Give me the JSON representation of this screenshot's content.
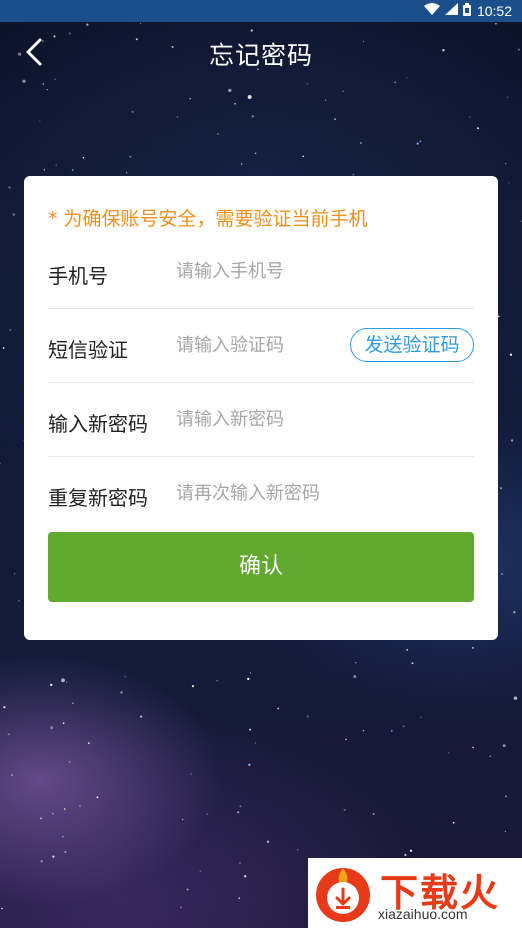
{
  "status_bar": {
    "time": "10:52",
    "icons": [
      "wifi-icon",
      "signal-icon",
      "battery-icon"
    ]
  },
  "header": {
    "title": "忘记密码",
    "back_icon": "back-arrow-icon"
  },
  "form": {
    "notice": "* 为确保账号安全，需要验证当前手机",
    "phone": {
      "label": "手机号",
      "placeholder": "请输入手机号",
      "value": ""
    },
    "sms": {
      "label": "短信验证",
      "placeholder": "请输入验证码",
      "value": "",
      "send_button": "发送验证码"
    },
    "new_password": {
      "label": "输入新密码",
      "placeholder": "请输入新密码",
      "value": ""
    },
    "repeat_password": {
      "label": "重复新密码",
      "placeholder": "请再次输入新密码",
      "value": ""
    },
    "confirm_button": "确认"
  },
  "watermark": {
    "brand": "下载火",
    "url": "xiazaihuo.com"
  },
  "colors": {
    "status_bar": "#1a4f8c",
    "notice": "#f0901c",
    "accent_blue": "#2f9be3",
    "confirm_green": "#62a92f",
    "brand_red": "#e83a18"
  }
}
